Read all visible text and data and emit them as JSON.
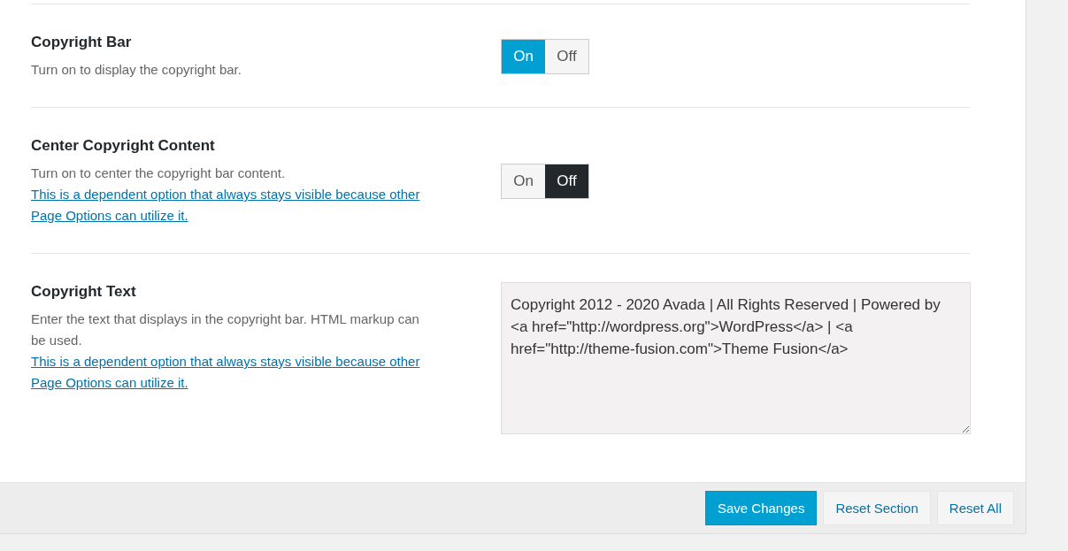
{
  "options": [
    {
      "kind": "toggle",
      "title": "Copyright Bar",
      "description": "Turn on to display the copyright bar.",
      "choices": [
        {
          "label": "On",
          "selected": true
        },
        {
          "label": "Off",
          "selected": false
        }
      ]
    },
    {
      "kind": "toggle",
      "title": "Center Copyright Content",
      "description": "Turn on to center the copyright bar content.",
      "link": "This is a dependent option that always stays visible because other Page Options can utilize it.",
      "choices": [
        {
          "label": "On",
          "selected": false
        },
        {
          "label": "Off",
          "selected": true
        }
      ]
    },
    {
      "kind": "textarea",
      "title": "Copyright Text",
      "description": "Enter the text that displays in the copyright bar. HTML markup can be used.",
      "link": "This is a dependent option that always stays visible because other Page Options can utilize it.",
      "value": "Copyright 2012 - 2020 Avada | All Rights Reserved | Powered by <a href=\"http://wordpress.org\">WordPress</a> | <a href=\"http://theme-fusion.com\">Theme Fusion</a>"
    }
  ],
  "footer": {
    "buttons": [
      {
        "label": "Save Changes",
        "kind": "primary"
      },
      {
        "label": "Reset Section",
        "kind": "secondary"
      },
      {
        "label": "Reset All",
        "kind": "secondary"
      }
    ]
  }
}
